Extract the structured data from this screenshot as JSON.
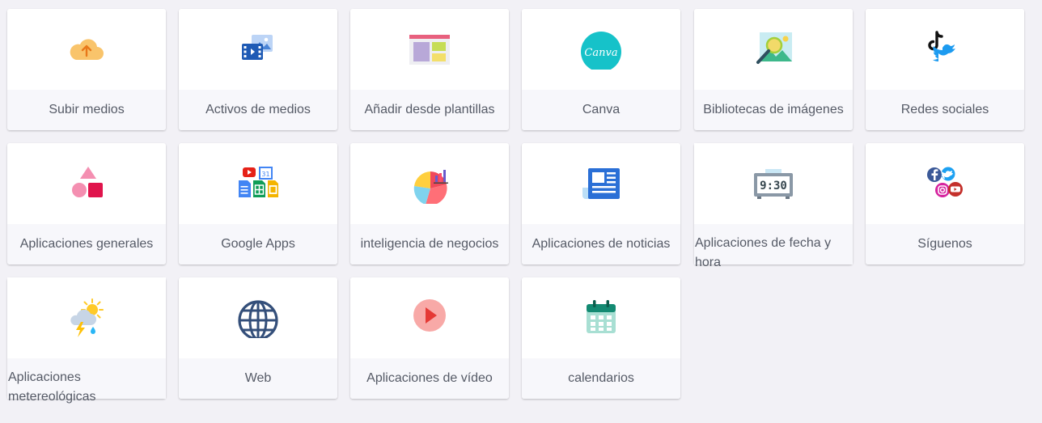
{
  "tiles": [
    {
      "label": "Subir medios",
      "icon": "cloud-upload-icon"
    },
    {
      "label": "Activos de medios",
      "icon": "media-assets-icon"
    },
    {
      "label": "Añadir desde plantillas",
      "icon": "templates-icon"
    },
    {
      "label": "Canva",
      "icon": "canva-icon",
      "icon_text": "Canva"
    },
    {
      "label": "Bibliotecas de imágenes",
      "icon": "image-library-icon"
    },
    {
      "label": "Redes sociales",
      "icon": "social-media-icon"
    },
    {
      "label": "Aplicaciones generales",
      "icon": "general-apps-icon"
    },
    {
      "label": "Google Apps",
      "icon": "google-apps-icon",
      "icon_text": "31"
    },
    {
      "label": "inteligencia de negocios",
      "icon": "business-intelligence-icon"
    },
    {
      "label": "Aplicaciones de noticias",
      "icon": "news-icon"
    },
    {
      "label": "Aplicaciones de fecha y hora",
      "icon": "clock-icon",
      "icon_text": "9:30"
    },
    {
      "label": "Síguenos",
      "icon": "follow-us-icon"
    },
    {
      "label": "Aplicaciones metereológicas",
      "icon": "weather-icon"
    },
    {
      "label": "Web",
      "icon": "globe-icon"
    },
    {
      "label": "Aplicaciones de vídeo",
      "icon": "video-play-icon"
    },
    {
      "label": "calendarios",
      "icon": "calendar-icon"
    }
  ],
  "colors": {
    "background": "#f2f1f6",
    "card": "#ffffff",
    "label_bg": "#f7f7fb",
    "label_text": "#555a66"
  }
}
